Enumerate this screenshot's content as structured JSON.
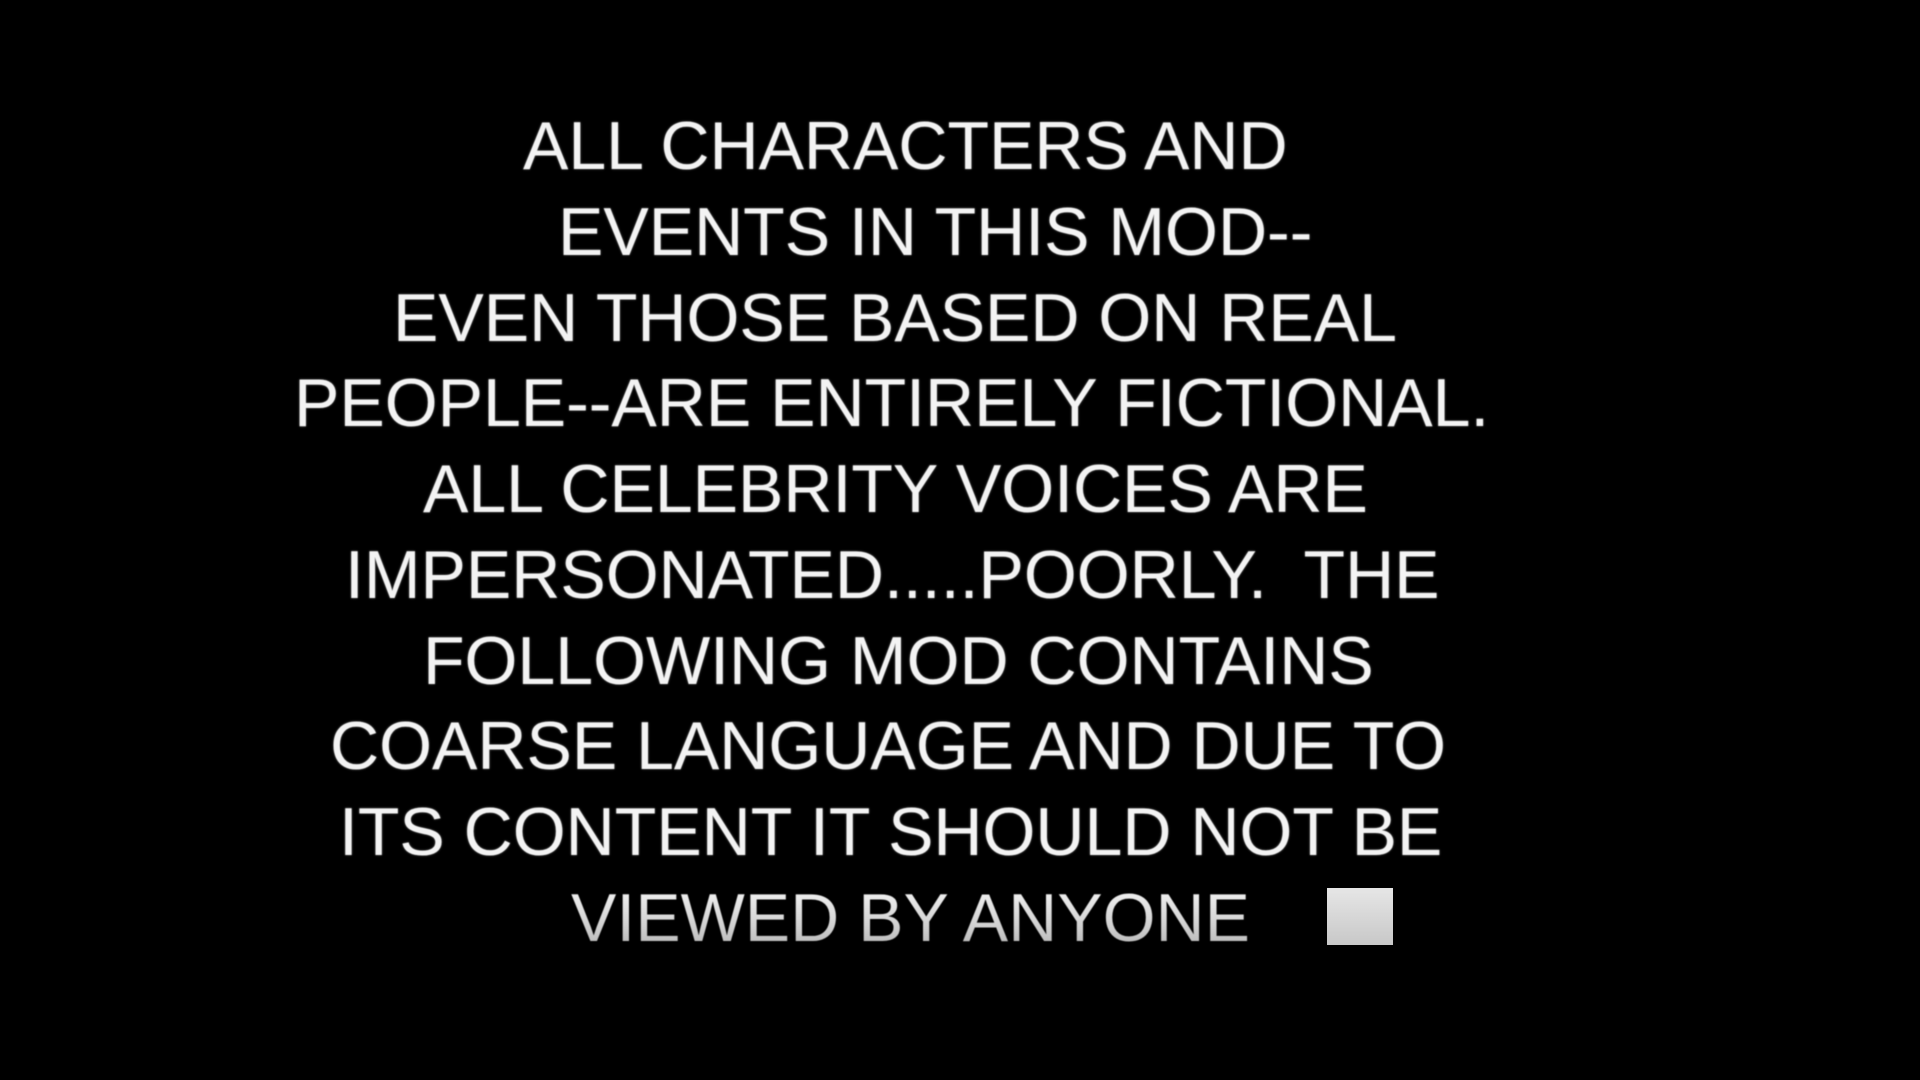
{
  "screen": {
    "background_color": "#000000",
    "text_color": "#f3f3f3"
  },
  "disclaimer": {
    "lines": [
      "ALL CHARACTERS AND",
      "EVENTS IN THIS MOD--",
      "EVEN THOSE BASED ON REAL",
      "PEOPLE--ARE ENTIRELY FICTIONAL.",
      "ALL CELEBRITY VOICES ARE",
      "IMPERSONATED.....POORLY.  THE",
      "FOLLOWING MOD CONTAINS",
      "COARSE LANGUAGE AND DUE TO",
      "ITS CONTENT IT SHOULD NOT BE",
      "VIEWED BY ANYONE"
    ]
  },
  "typing_cursor": {
    "icon": "block-cursor-icon",
    "color": "#d9d9d9"
  }
}
